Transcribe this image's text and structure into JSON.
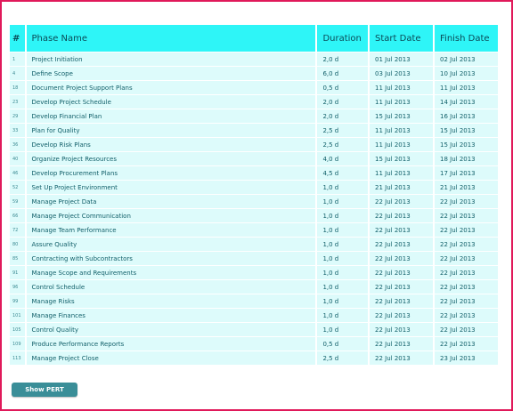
{
  "table": {
    "headers": {
      "num": "#",
      "name": "Phase Name",
      "duration": "Duration",
      "start": "Start Date",
      "finish": "Finish Date"
    },
    "rows": [
      {
        "id": "1",
        "name": "Project Initiation",
        "duration": "2,0 d",
        "start": "01 Jul 2013",
        "finish": "02 Jul 2013"
      },
      {
        "id": "4",
        "name": "Define Scope",
        "duration": "6,0 d",
        "start": "03 Jul 2013",
        "finish": "10 Jul 2013"
      },
      {
        "id": "18",
        "name": "Document Project Support Plans",
        "duration": "0,5 d",
        "start": "11 Jul 2013",
        "finish": "11 Jul 2013"
      },
      {
        "id": "23",
        "name": "Develop Project Schedule",
        "duration": "2,0 d",
        "start": "11 Jul 2013",
        "finish": "14 Jul 2013"
      },
      {
        "id": "29",
        "name": "Develop Financial Plan",
        "duration": "2,0 d",
        "start": "15 Jul 2013",
        "finish": "16 Jul 2013"
      },
      {
        "id": "33",
        "name": "Plan for Quality",
        "duration": "2,5 d",
        "start": "11 Jul 2013",
        "finish": "15 Jul 2013"
      },
      {
        "id": "36",
        "name": "Develop Risk Plans",
        "duration": "2,5 d",
        "start": "11 Jul 2013",
        "finish": "15 Jul 2013"
      },
      {
        "id": "40",
        "name": "Organize Project Resources",
        "duration": "4,0 d",
        "start": "15 Jul 2013",
        "finish": "18 Jul 2013"
      },
      {
        "id": "46",
        "name": "Develop Procurement Plans",
        "duration": "4,5 d",
        "start": "11 Jul 2013",
        "finish": "17 Jul 2013"
      },
      {
        "id": "52",
        "name": "Set Up Project Environment",
        "duration": "1,0 d",
        "start": "21 Jul 2013",
        "finish": "21 Jul 2013"
      },
      {
        "id": "59",
        "name": "Manage Project Data",
        "duration": "1,0 d",
        "start": "22 Jul 2013",
        "finish": "22 Jul 2013"
      },
      {
        "id": "66",
        "name": "Manage Project Communication",
        "duration": "1,0 d",
        "start": "22 Jul 2013",
        "finish": "22 Jul 2013"
      },
      {
        "id": "72",
        "name": "Manage Team Performance",
        "duration": "1,0 d",
        "start": "22 Jul 2013",
        "finish": "22 Jul 2013"
      },
      {
        "id": "80",
        "name": "Assure Quality",
        "duration": "1,0 d",
        "start": "22 Jul 2013",
        "finish": "22 Jul 2013"
      },
      {
        "id": "85",
        "name": "Contracting with Subcontractors",
        "duration": "1,0 d",
        "start": "22 Jul 2013",
        "finish": "22 Jul 2013"
      },
      {
        "id": "91",
        "name": "Manage Scope and Requirements",
        "duration": "1,0 d",
        "start": "22 Jul 2013",
        "finish": "22 Jul 2013"
      },
      {
        "id": "96",
        "name": "Control Schedule",
        "duration": "1,0 d",
        "start": "22 Jul 2013",
        "finish": "22 Jul 2013"
      },
      {
        "id": "99",
        "name": "Manage Risks",
        "duration": "1,0 d",
        "start": "22 Jul 2013",
        "finish": "22 Jul 2013"
      },
      {
        "id": "101",
        "name": "Manage Finances",
        "duration": "1,0 d",
        "start": "22 Jul 2013",
        "finish": "22 Jul 2013"
      },
      {
        "id": "105",
        "name": "Control Quality",
        "duration": "1,0 d",
        "start": "22 Jul 2013",
        "finish": "22 Jul 2013"
      },
      {
        "id": "109",
        "name": "Produce Performance Reports",
        "duration": "0,5 d",
        "start": "22 Jul 2013",
        "finish": "22 Jul 2013"
      },
      {
        "id": "113",
        "name": "Manage Project Close",
        "duration": "2,5 d",
        "start": "22 Jul 2013",
        "finish": "23 Jul 2013"
      }
    ]
  },
  "actions": {
    "show_pert": "Show PERT"
  },
  "colors": {
    "header_bg": "#2ef5f7",
    "row_bg": "#ddfbfb",
    "button_bg": "#3a8e98",
    "frame": "#e0195a"
  }
}
